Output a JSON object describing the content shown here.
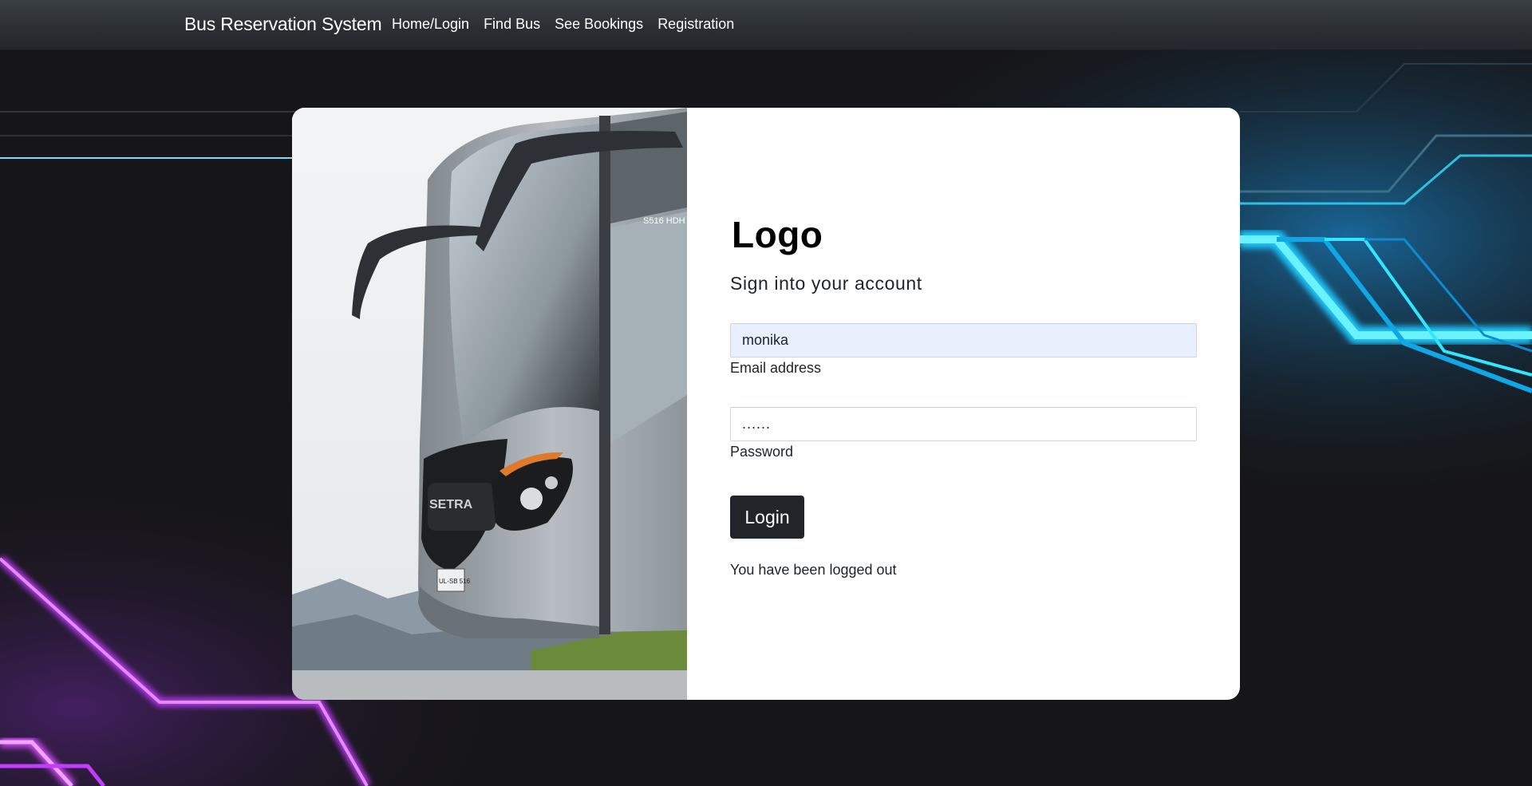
{
  "navbar": {
    "brand": "Bus Reservation System",
    "links": [
      {
        "label": "Home/Login"
      },
      {
        "label": "Find Bus"
      },
      {
        "label": "See Bookings"
      },
      {
        "label": "Registration"
      }
    ]
  },
  "login": {
    "logo_text": "Logo",
    "logo_icon": "cubes-icon",
    "subtitle": "Sign into your account",
    "email_value": "monika",
    "email_label": "Email address",
    "password_value": "......",
    "password_label": "Password",
    "login_button": "Login",
    "status_message": "You have been logged out"
  },
  "bus_image": {
    "plate_sign": "S516 HDH",
    "brand_badge": "SETRA",
    "plate_number": "UL-SB 516"
  },
  "colors": {
    "navbar_bg": "#343a40",
    "button_bg": "#212529",
    "autofill_bg": "#e8f0fe",
    "accent_cyan": "#2ee6ff",
    "accent_magenta": "#d94cff"
  }
}
